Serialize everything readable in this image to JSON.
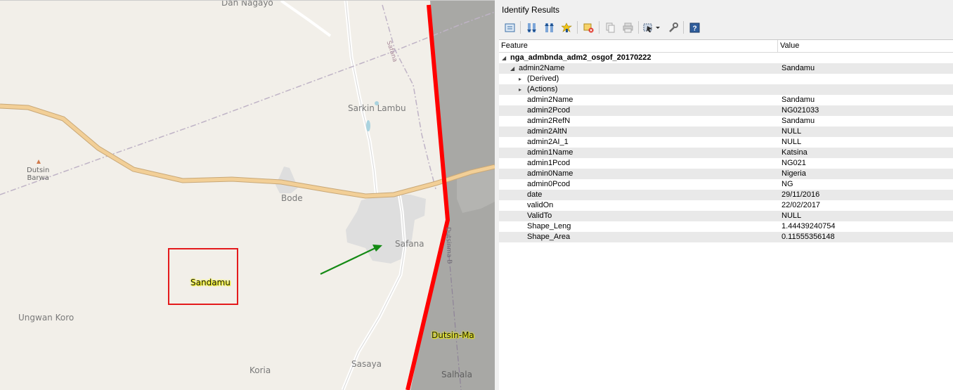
{
  "map": {
    "labels": {
      "dan_nagayo": "Dan Nagayo",
      "safana_road": "Safana",
      "sarkin_lambu": "Sarkin Lambu",
      "dutsin_barwa": "Dutsin\nBarwa",
      "bode": "Bode",
      "safana": "Safana",
      "dutsinma_road": "Dutsinma B",
      "sandamu": "Sandamu",
      "ungwan_koro": "Ungwan Koro",
      "dutsin_ma": "Dutsin-Ma",
      "koria": "Koria",
      "sasaya": "Sasaya",
      "salhala": "Salhala"
    },
    "colors": {
      "background": "#f2efe9",
      "boundary": "#ff0000",
      "highlight_box": "#e41a1c",
      "pointer_arrow": "#148a14",
      "major_road": "#f2cf97",
      "outside_area": "#a8a8a5",
      "built_up": "#dedede"
    }
  },
  "panel": {
    "title": "Identify Results",
    "toolbar": [
      {
        "name": "expand-tree-icon"
      },
      {
        "name": "expand-all-icon"
      },
      {
        "name": "collapse-all-icon"
      },
      {
        "name": "expand-new-results-icon"
      },
      {
        "name": "clear-results-icon"
      },
      {
        "name": "copy-feature-icon"
      },
      {
        "name": "print-icon"
      },
      {
        "name": "select-features-icon"
      },
      {
        "name": "identify-settings-icon"
      },
      {
        "name": "help-icon"
      }
    ],
    "columns": {
      "feature": "Feature",
      "value": "Value"
    },
    "layer_name": "nga_admbnda_adm2_osgof_20170222",
    "feature_name": "admin2Name",
    "feature_value": "Sandamu",
    "derived_label": "(Derived)",
    "actions_label": "(Actions)",
    "attributes": [
      {
        "name": "admin2Name",
        "value": "Sandamu"
      },
      {
        "name": "admin2Pcod",
        "value": "NG021033"
      },
      {
        "name": "admin2RefN",
        "value": "Sandamu"
      },
      {
        "name": "admin2AltN",
        "value": "NULL"
      },
      {
        "name": "admin2AI_1",
        "value": "NULL"
      },
      {
        "name": "admin1Name",
        "value": "Katsina"
      },
      {
        "name": "admin1Pcod",
        "value": "NG021"
      },
      {
        "name": "admin0Name",
        "value": "Nigeria"
      },
      {
        "name": "admin0Pcod",
        "value": "NG"
      },
      {
        "name": "date",
        "value": "29/11/2016"
      },
      {
        "name": "validOn",
        "value": "22/02/2017"
      },
      {
        "name": "ValidTo",
        "value": "NULL"
      },
      {
        "name": "Shape_Leng",
        "value": "1.44439240754"
      },
      {
        "name": "Shape_Area",
        "value": "0.11555356148"
      }
    ]
  }
}
